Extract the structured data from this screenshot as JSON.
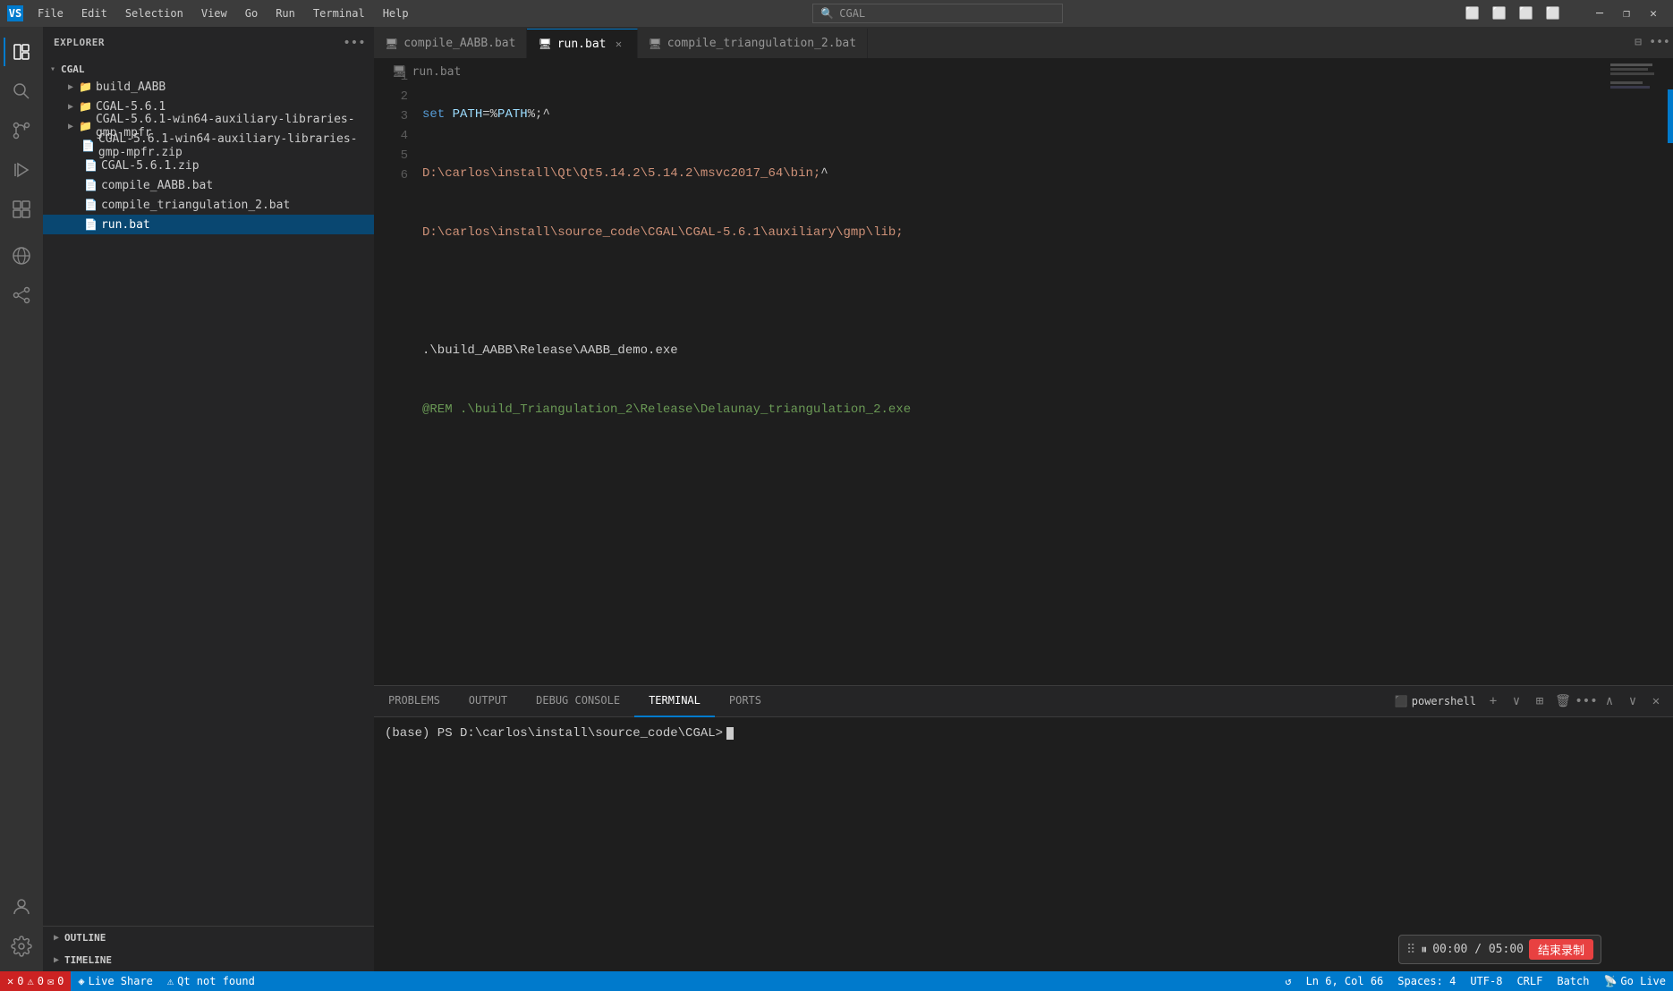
{
  "titlebar": {
    "menu": [
      "File",
      "Edit",
      "Selection",
      "View",
      "Go",
      "Run",
      "Terminal",
      "Help"
    ],
    "search_placeholder": "CGAL",
    "back_icon": "◀",
    "forward_icon": "▶",
    "minimize": "─",
    "maximize": "□",
    "restore": "❐",
    "close": "✕",
    "layout_icons": [
      "⬜",
      "⬜",
      "⬜",
      "⬜"
    ]
  },
  "activity_bar": {
    "icons": [
      {
        "name": "explorer-icon",
        "symbol": "⎘",
        "active": true
      },
      {
        "name": "search-icon",
        "symbol": "🔍"
      },
      {
        "name": "source-control-icon",
        "symbol": "⎇"
      },
      {
        "name": "run-debug-icon",
        "symbol": "▷"
      },
      {
        "name": "extensions-icon",
        "symbol": "⊞"
      },
      {
        "name": "remote-explorer-icon",
        "symbol": "⊙"
      },
      {
        "name": "live-share-icon",
        "symbol": "◈"
      }
    ],
    "bottom_icons": [
      {
        "name": "account-icon",
        "symbol": "👤"
      },
      {
        "name": "settings-icon",
        "symbol": "⚙"
      }
    ]
  },
  "sidebar": {
    "title": "EXPLORER",
    "actions_icon": "•••",
    "tree": {
      "root": "CGAL",
      "items": [
        {
          "label": "build_AABB",
          "type": "folder",
          "depth": 1
        },
        {
          "label": "CGAL-5.6.1",
          "type": "folder",
          "depth": 1
        },
        {
          "label": "CGAL-5.6.1-win64-auxiliary-libraries-gmp-mpfr",
          "type": "folder",
          "depth": 1
        },
        {
          "label": "CGAL-5.6.1-win64-auxiliary-libraries-gmp-mpfr.zip",
          "type": "zip",
          "depth": 1
        },
        {
          "label": "CGAL-5.6.1.zip",
          "type": "zip",
          "depth": 1
        },
        {
          "label": "compile_AABB.bat",
          "type": "bat",
          "depth": 1
        },
        {
          "label": "compile_triangulation_2.bat",
          "type": "bat",
          "depth": 1
        },
        {
          "label": "run.bat",
          "type": "bat",
          "depth": 1,
          "active": true
        }
      ]
    },
    "outline": "OUTLINE",
    "timeline": "TIMELINE"
  },
  "tabs": [
    {
      "label": "compile_AABB.bat",
      "icon": "🖥",
      "active": false,
      "closeable": false
    },
    {
      "label": "run.bat",
      "icon": "🖥",
      "active": true,
      "closeable": true
    },
    {
      "label": "compile_triangulation_2.bat",
      "icon": "🖥",
      "active": false,
      "closeable": false
    }
  ],
  "editor": {
    "file_label": "run.bat",
    "file_icon": "🖥",
    "lines": [
      {
        "num": 1,
        "content": "set PATH=%PATH%;^"
      },
      {
        "num": 2,
        "content": "D:\\carlos\\install\\Qt\\Qt5.14.2\\5.14.2\\msvc2017_64\\bin;^"
      },
      {
        "num": 3,
        "content": "D:\\carlos\\install\\source_code\\CGAL\\CGAL-5.6.1\\auxiliary\\gmp\\lib;"
      },
      {
        "num": 4,
        "content": ""
      },
      {
        "num": 5,
        "content": ".\\build_AABB\\Release\\AABB_demo.exe"
      },
      {
        "num": 6,
        "content": "@REM .\\build_Triangulation_2\\Release\\Delaunay_triangulation_2.exe"
      }
    ]
  },
  "terminal": {
    "tabs": [
      "PROBLEMS",
      "OUTPUT",
      "DEBUG CONSOLE",
      "TERMINAL",
      "PORTS"
    ],
    "active_tab": "TERMINAL",
    "powershell_label": "powershell",
    "prompt": "(base) PS D:\\carlos\\install\\source_code\\CGAL> ",
    "add_icon": "+",
    "split_icon": "⊞",
    "trash_icon": "🗑",
    "more_icon": "•••",
    "chevron_up": "∧",
    "chevron_down": "∨",
    "close_icon": "✕"
  },
  "status_bar": {
    "error_icon": "✕",
    "error_count": "0",
    "warning_icon": "⚠",
    "warning_count": "0",
    "msg_icon": "✉",
    "msg_count": "0",
    "live_share": "Live Share",
    "qt_not_found": "Qt not found",
    "line_col": "Ln 6, Col 66",
    "spaces": "Spaces: 4",
    "encoding": "UTF-8",
    "line_ending": "CRLF",
    "language": "Batch",
    "go_live": "Go Live",
    "sync_icon": "↺"
  },
  "recording": {
    "drag_icon": "⠿",
    "pause_icon": "⏸",
    "time": "00:00 / 05:00",
    "stop_label": "结束录制"
  }
}
